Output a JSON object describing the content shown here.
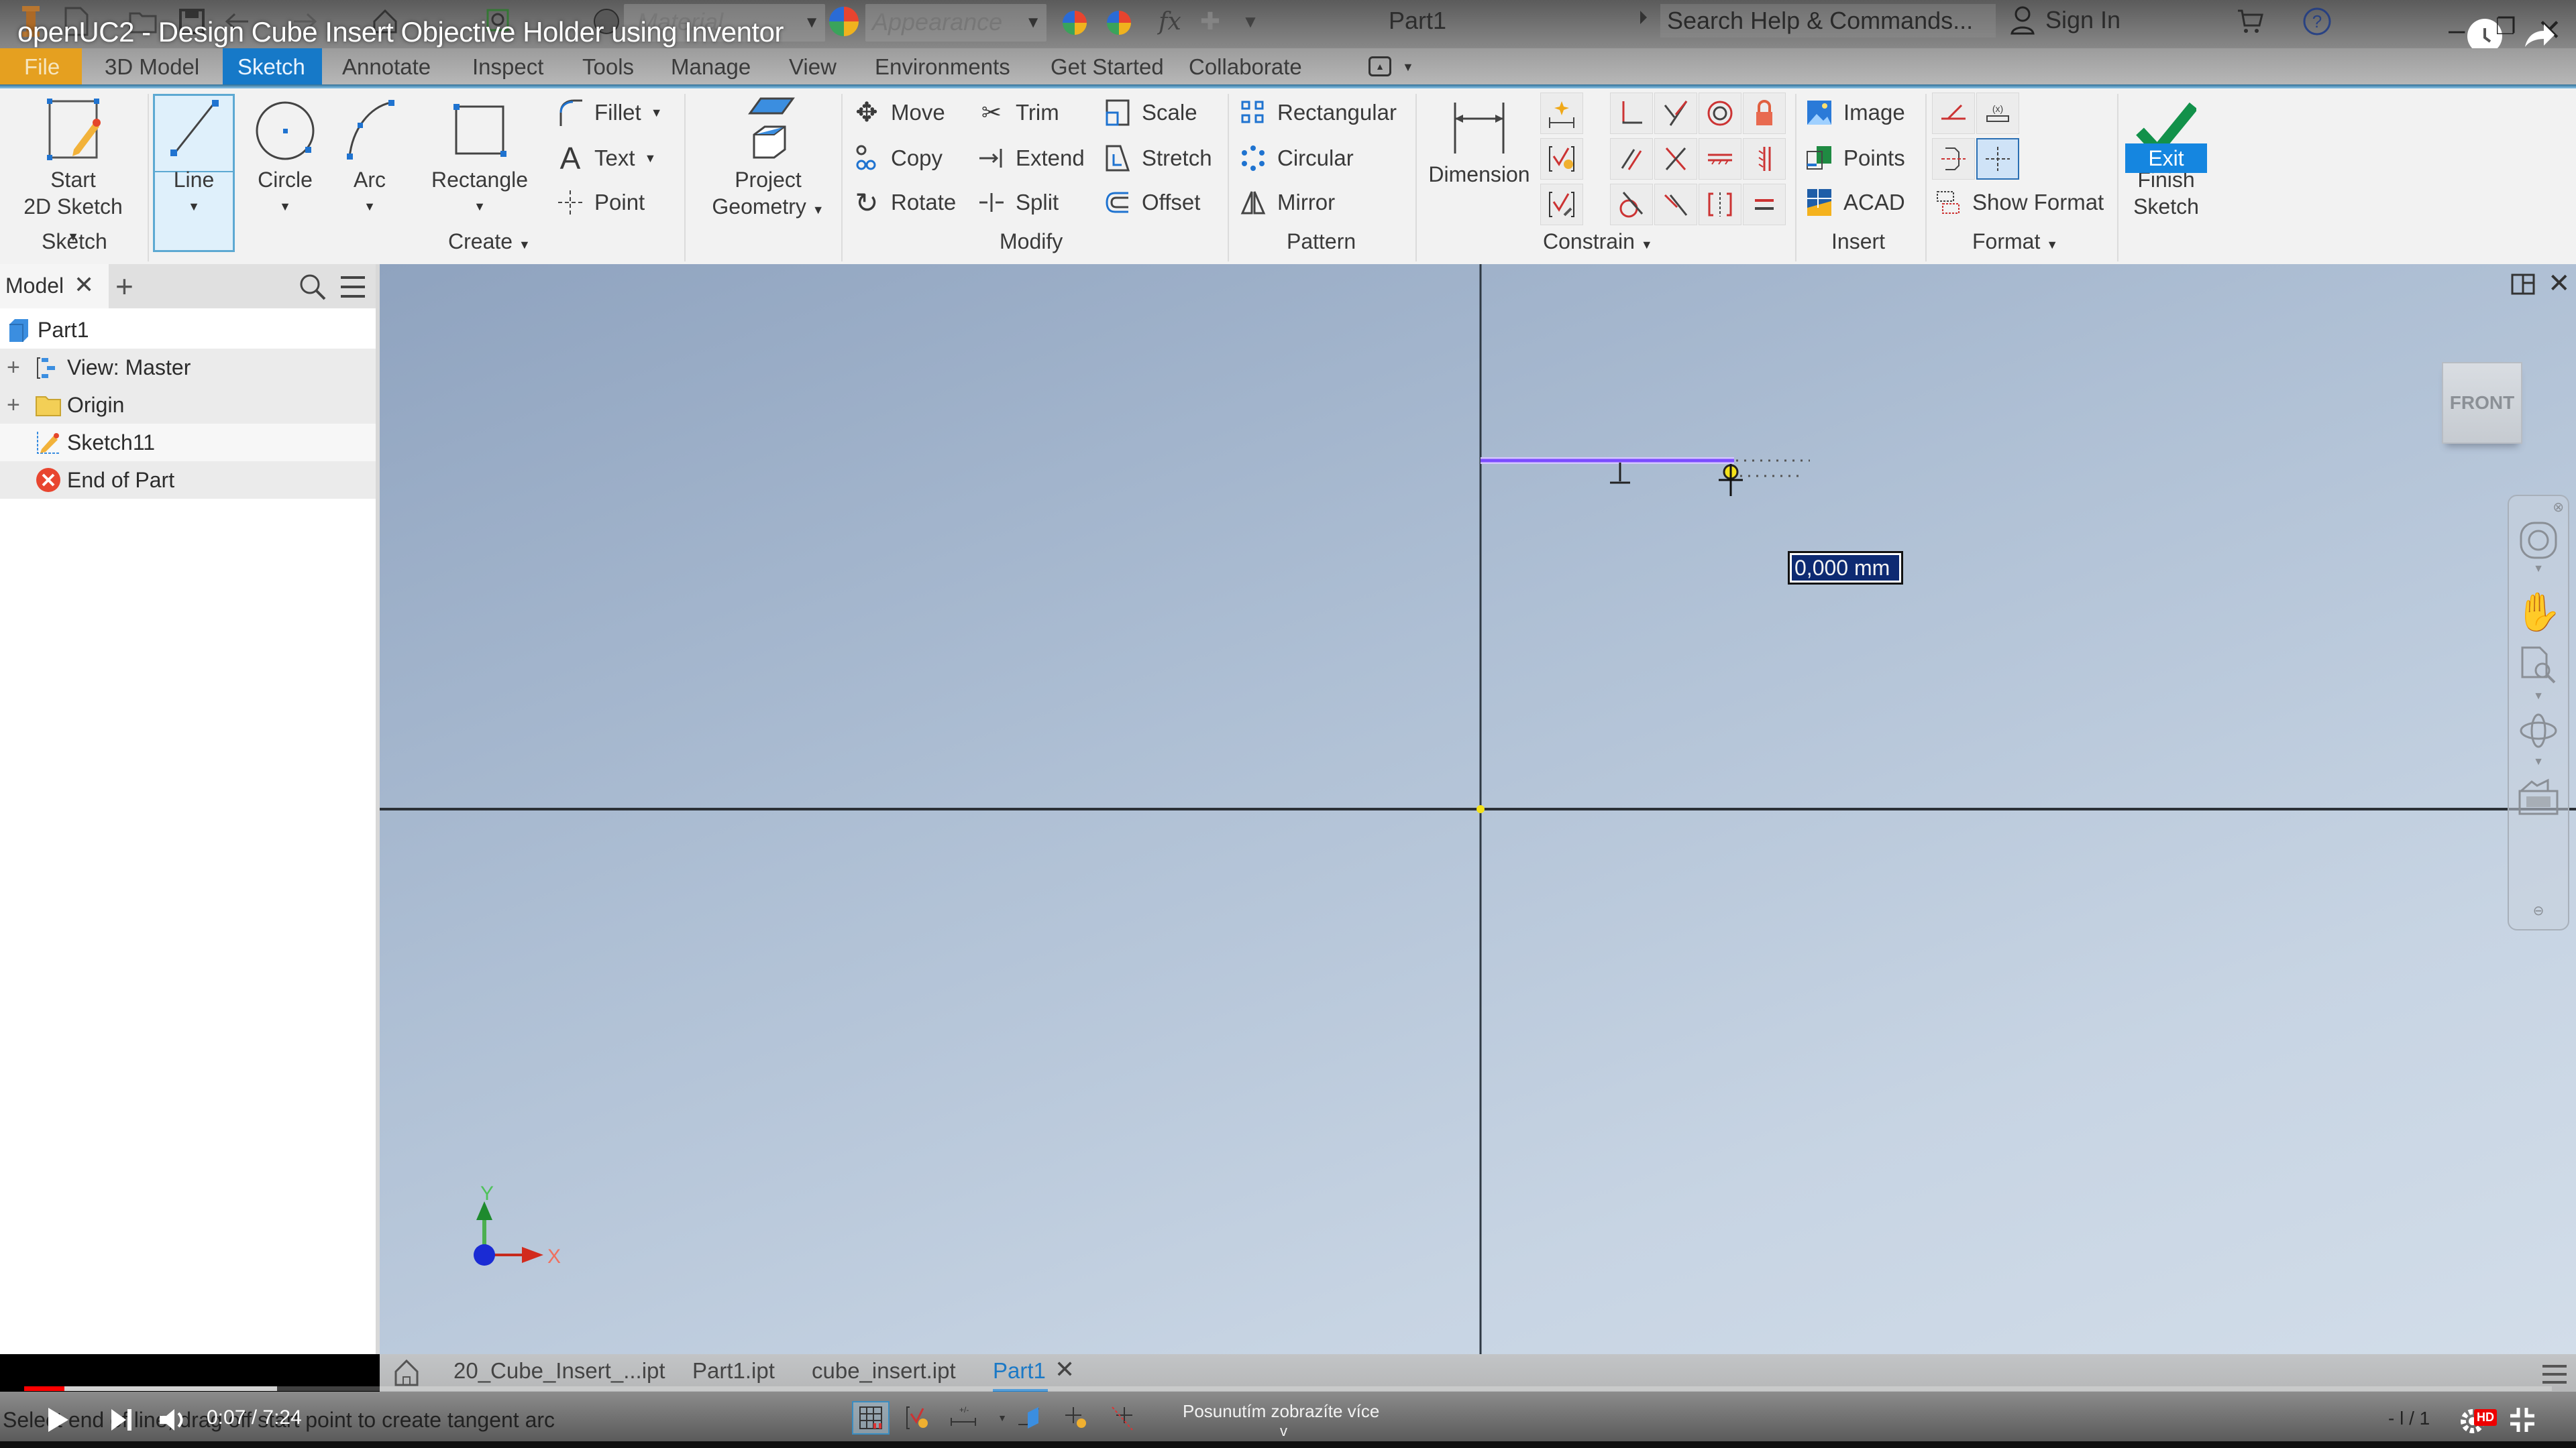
{
  "video": {
    "title": "openUC2 - Design Cube Insert Objective Holder using Inventor",
    "time_current": "0:07",
    "time_total": "7:24",
    "time_display": "0:07 / 7:24",
    "progress_fraction": 0.016,
    "buffered_fraction": 0.1,
    "tooltip": "Posunutím zobrazíte více",
    "tooltip_chevron": "v",
    "hd_badge": "HD"
  },
  "quick_access": {
    "material_placeholder": "Material",
    "appearance_placeholder": "Appearance",
    "document_name": "Part1",
    "search_placeholder": "Search Help & Commands...",
    "sign_in_label": "Sign In"
  },
  "ribbon_tabs": [
    {
      "label": "File",
      "state": "file"
    },
    {
      "label": "3D Model"
    },
    {
      "label": "Sketch",
      "state": "active"
    },
    {
      "label": "Annotate"
    },
    {
      "label": "Inspect"
    },
    {
      "label": "Tools"
    },
    {
      "label": "Manage"
    },
    {
      "label": "View"
    },
    {
      "label": "Environments"
    },
    {
      "label": "Get Started"
    },
    {
      "label": "Collaborate"
    }
  ],
  "ribbon": {
    "sketch_panel": {
      "label": "Sketch",
      "start_2d_sketch_line1": "Start",
      "start_2d_sketch_line2": "2D Sketch"
    },
    "create_panel": {
      "label": "Create",
      "line": "Line",
      "circle": "Circle",
      "arc": "Arc",
      "rectangle": "Rectangle",
      "fillet": "Fillet",
      "text": "Text",
      "point": "Point",
      "project_geometry_line1": "Project",
      "project_geometry_line2": "Geometry"
    },
    "modify_panel": {
      "label": "Modify",
      "move": "Move",
      "copy": "Copy",
      "rotate": "Rotate",
      "trim": "Trim",
      "extend": "Extend",
      "split": "Split",
      "scale": "Scale",
      "stretch": "Stretch",
      "offset": "Offset"
    },
    "pattern_panel": {
      "label": "Pattern",
      "rectangular": "Rectangular",
      "circular": "Circular",
      "mirror": "Mirror"
    },
    "constrain_panel": {
      "label": "Constrain",
      "dimension": "Dimension"
    },
    "insert_panel": {
      "label": "Insert",
      "image": "Image",
      "points": "Points",
      "acad": "ACAD"
    },
    "format_panel": {
      "label": "Format",
      "show_format": "Show Format"
    },
    "exit_panel": {
      "label": "Exit",
      "finish_sketch_line1": "Finish",
      "finish_sketch_line2": "Sketch"
    }
  },
  "browser": {
    "tab_label": "Model",
    "tree": [
      {
        "label": "Part1",
        "icon": "part-cube-icon",
        "level": 0
      },
      {
        "label": "View: Master",
        "icon": "view-rep-icon",
        "level": 1,
        "expandable": true
      },
      {
        "label": "Origin",
        "icon": "folder-icon",
        "level": 1,
        "expandable": true
      },
      {
        "label": "Sketch11",
        "icon": "sketch-icon",
        "level": 1
      },
      {
        "label": "End of Part",
        "icon": "end-of-part-icon",
        "level": 1
      }
    ]
  },
  "canvas": {
    "viewcube_face": "FRONT",
    "dimension_input_value": "0,000 mm",
    "triad_x_label": "X",
    "triad_y_label": "Y",
    "colors": {
      "sketch_line": "#7b4dff",
      "axis_x": "#d22b1e",
      "axis_y": "#2d9a34",
      "origin": "#1a2bd4",
      "origin_point": "#f4e21a"
    }
  },
  "document_tabs": [
    {
      "label": "20_Cube_Insert_...ipt"
    },
    {
      "label": "Part1.ipt"
    },
    {
      "label": "cube_insert.ipt"
    },
    {
      "label": "Part1",
      "active": true,
      "closable": true
    }
  ],
  "status_bar": {
    "message": "Select end of line, drag off start point to create tangent arc",
    "page_indicator": "1"
  },
  "colors": {
    "accent": "#1679c8",
    "file_tab": "#e5a020",
    "exit_button": "#1586e0",
    "finish_check": "#12914a",
    "yt_red": "#ff0000"
  }
}
